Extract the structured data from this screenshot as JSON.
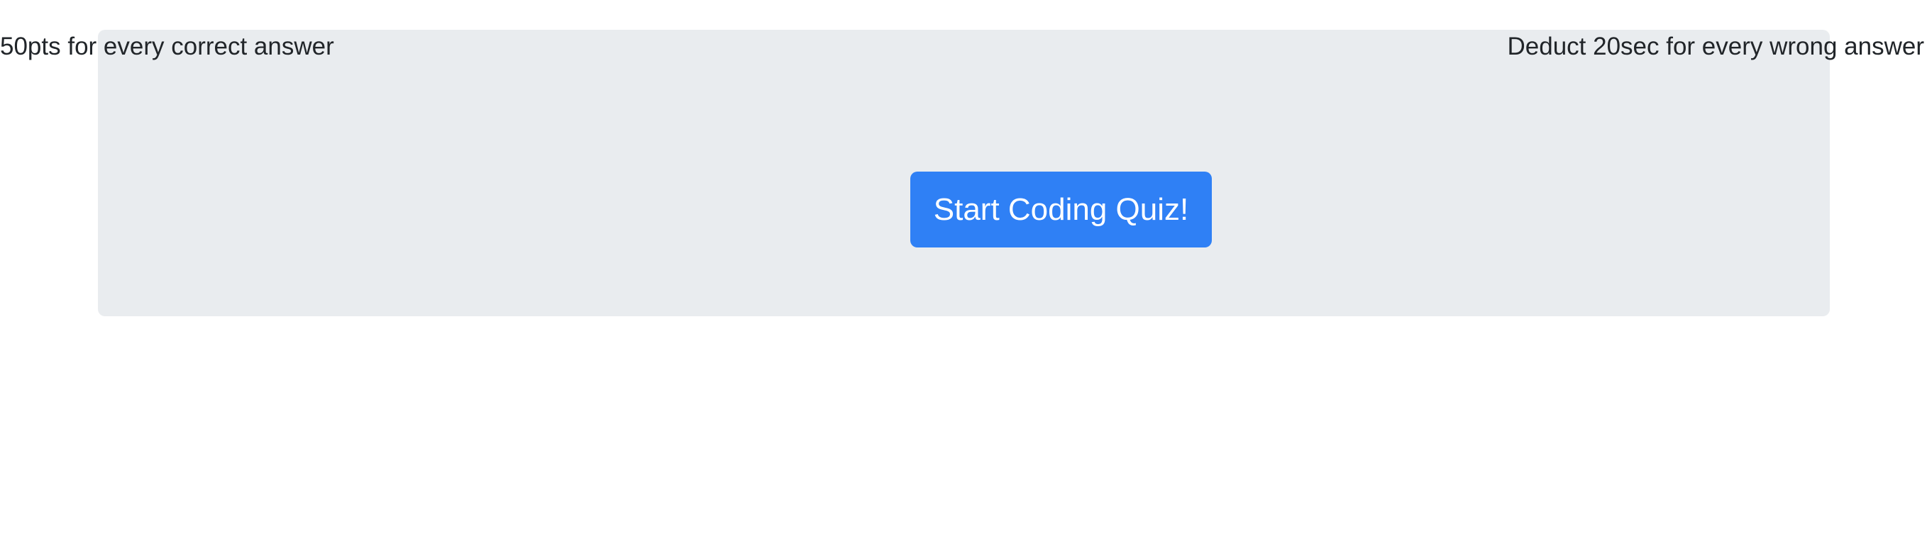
{
  "rules": {
    "correct": "50pts for every correct answer",
    "wrong": "Deduct 20sec for every wrong answer"
  },
  "start": {
    "label": "Start Coding Quiz!"
  },
  "colors": {
    "panel_background": "#e9ecef",
    "button_background": "#2f80f5",
    "button_text": "#ffffff",
    "text": "#212529"
  }
}
